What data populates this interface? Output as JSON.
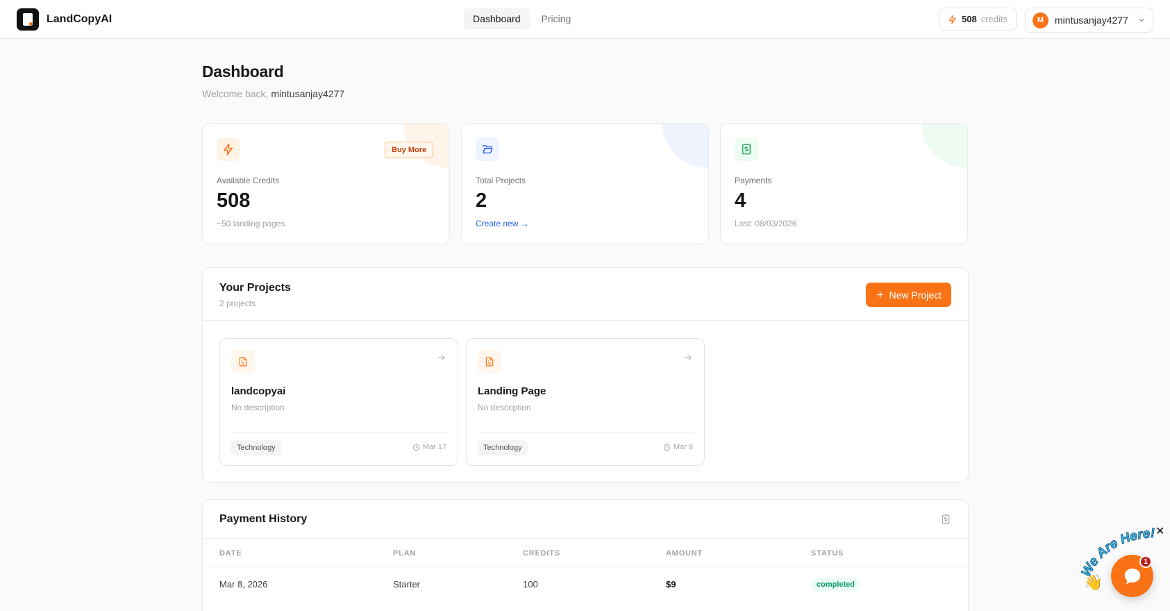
{
  "brand": {
    "name": "LandCopyAI"
  },
  "nav": {
    "items": [
      {
        "label": "Dashboard",
        "active": true
      },
      {
        "label": "Pricing",
        "active": false
      }
    ]
  },
  "header": {
    "credits_value": "508",
    "credits_label": "credits",
    "avatar_initial": "M",
    "username": "mintusanjay4277"
  },
  "page": {
    "title": "Dashboard",
    "welcome_prefix": "Welcome back,",
    "welcome_name": "mintusanjay4277"
  },
  "stats": {
    "credits": {
      "label": "Available Credits",
      "value": "508",
      "sub": "~50 landing pages",
      "button": "Buy More",
      "icon": "lightning-icon"
    },
    "projects": {
      "label": "Total Projects",
      "value": "2",
      "link": "Create new →",
      "icon": "folder-open-icon"
    },
    "payments": {
      "label": "Payments",
      "value": "4",
      "sub": "Last: 08/03/2026",
      "icon": "receipt-icon"
    }
  },
  "projects_section": {
    "title": "Your Projects",
    "subtitle": "2 projects",
    "new_button": "New Project",
    "items": [
      {
        "name": "landcopyai",
        "description": "No description",
        "tag": "Technology",
        "date": "Mar 17"
      },
      {
        "name": "Landing Page",
        "description": "No description",
        "tag": "Technology",
        "date": "Mar 8"
      }
    ]
  },
  "payment_history": {
    "title": "Payment History",
    "columns": [
      "DATE",
      "PLAN",
      "CREDITS",
      "AMOUNT",
      "STATUS"
    ],
    "rows": [
      {
        "date": "Mar 8, 2026",
        "plan": "Starter",
        "credits": "100",
        "amount": "$9",
        "status": "completed"
      }
    ]
  },
  "chat_widget": {
    "banner": "We Are Here!",
    "badge": "1",
    "close": "✕"
  },
  "colors": {
    "accent": "#f97316",
    "link": "#2563eb",
    "success": "#059669"
  }
}
